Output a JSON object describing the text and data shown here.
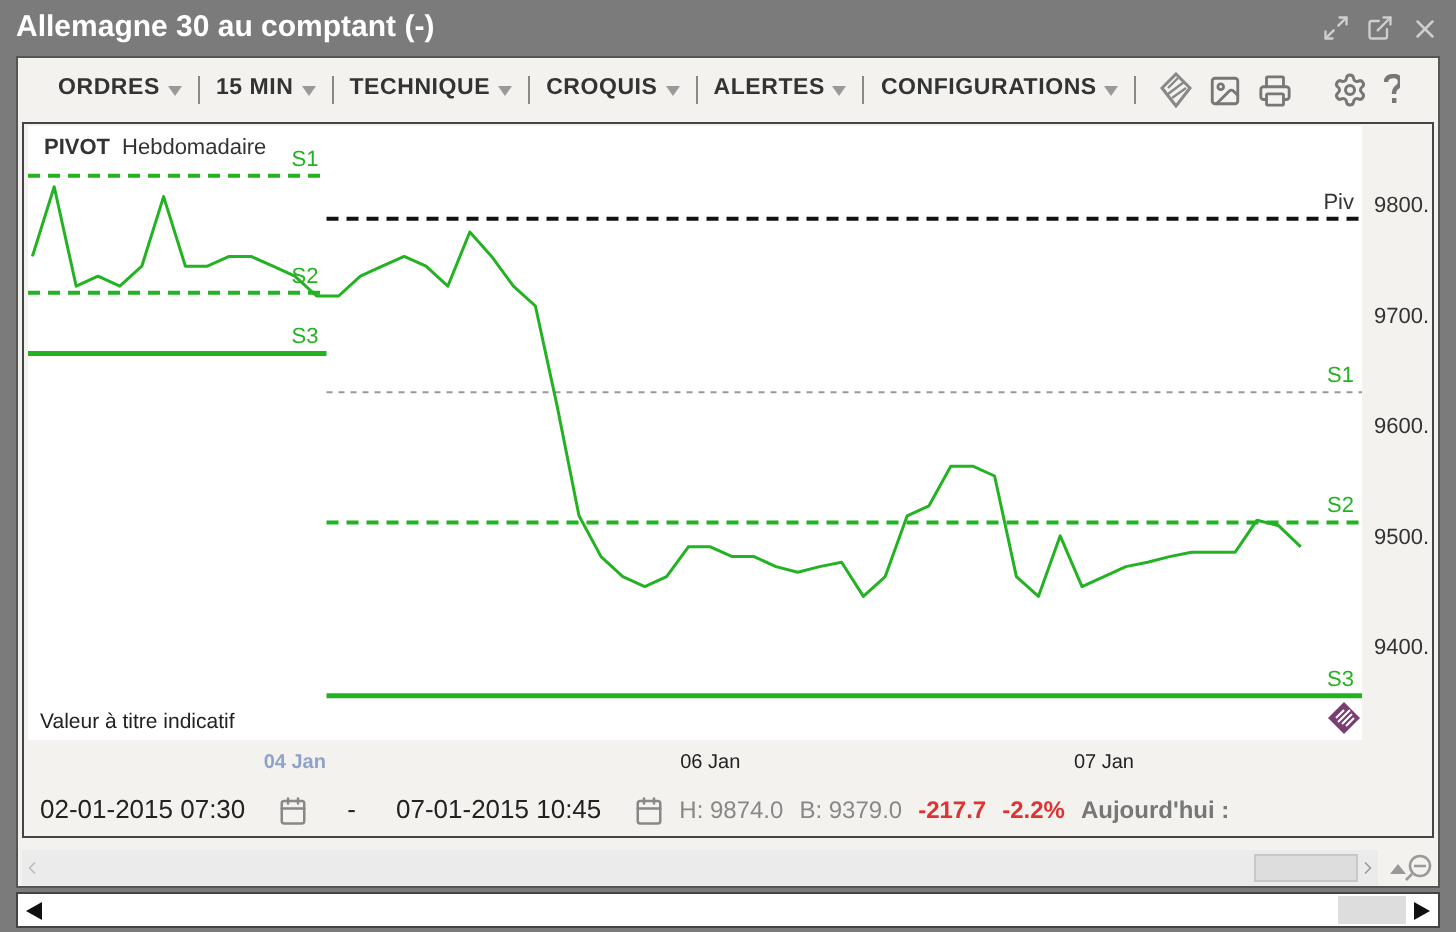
{
  "window": {
    "title": "Allemagne 30 au comptant (-)"
  },
  "toolbar": {
    "menus": [
      {
        "label": "ORDRES"
      },
      {
        "label": "15 MIN"
      },
      {
        "label": "TECHNIQUE"
      },
      {
        "label": "CROQUIS"
      },
      {
        "label": "ALERTES"
      },
      {
        "label": "CONFIGURATIONS"
      }
    ]
  },
  "chart": {
    "legend": {
      "indicator": "PIVOT",
      "period": "Hebdomadaire"
    },
    "note": "Valeur à titre indicatif",
    "chart_data": {
      "type": "line",
      "categories": [
        null,
        null,
        null,
        null,
        null,
        null,
        null,
        null,
        null,
        null,
        null,
        null,
        "04 Jan",
        null,
        null,
        null,
        null,
        null,
        null,
        null,
        null,
        null,
        null,
        null,
        null,
        null,
        null,
        null,
        null,
        null,
        null,
        "06 Jan",
        null,
        null,
        null,
        null,
        null,
        null,
        null,
        null,
        null,
        null,
        null,
        null,
        null,
        null,
        null,
        null,
        null,
        "07 Jan",
        null,
        null,
        null,
        null,
        null,
        null,
        null,
        null,
        null
      ],
      "series": [
        {
          "color": "#22b222",
          "values": [
            9753,
            9816,
            9726,
            9735,
            9726,
            9744,
            9807,
            9744,
            9744,
            9753,
            9753,
            9744,
            9735,
            9717,
            9717,
            9735,
            9744,
            9753,
            9744,
            9726,
            9775,
            9753,
            9726,
            9708,
            9617,
            9518,
            9481,
            9463,
            9454,
            9463,
            9490,
            9490,
            9481,
            9481,
            9472,
            9467,
            9472,
            9476,
            9445,
            9463,
            9518,
            9527,
            9563,
            9563,
            9554,
            9463,
            9445,
            9500,
            9454,
            9463,
            9472,
            9476,
            9481,
            9485,
            9485,
            9485,
            9514,
            9509,
            9490
          ]
        }
      ],
      "ylim": [
        9315,
        9871
      ],
      "yticks": [
        {
          "value": 9400,
          "label": "9400."
        },
        {
          "value": 9500,
          "label": "9500."
        },
        {
          "value": 9600,
          "label": "9600."
        },
        {
          "value": 9700,
          "label": "9700."
        },
        {
          "value": 9800,
          "label": "9800."
        }
      ],
      "ref_lines": [
        {
          "axis": "y",
          "value": 9826,
          "label": "S1"
        },
        {
          "axis": "y",
          "value": 9720,
          "label": "S2"
        },
        {
          "axis": "y",
          "value": 9665,
          "label": "S3"
        },
        {
          "axis": "y",
          "value": 9787,
          "label": "Piv"
        },
        {
          "axis": "y",
          "value": 9630,
          "label": "S1"
        },
        {
          "axis": "y",
          "value": 9512,
          "label": "S2"
        },
        {
          "axis": "y",
          "value": 9355,
          "label": "S3"
        }
      ]
    }
  },
  "footer": {
    "start": "02-01-2015 07:30",
    "separator": "-",
    "end": "07-01-2015 10:45",
    "high": "H: 9874.0",
    "low": "B: 9379.0",
    "change": "-217.7",
    "change_pct": "-2.2%",
    "today": "Aujourd'hui :"
  }
}
